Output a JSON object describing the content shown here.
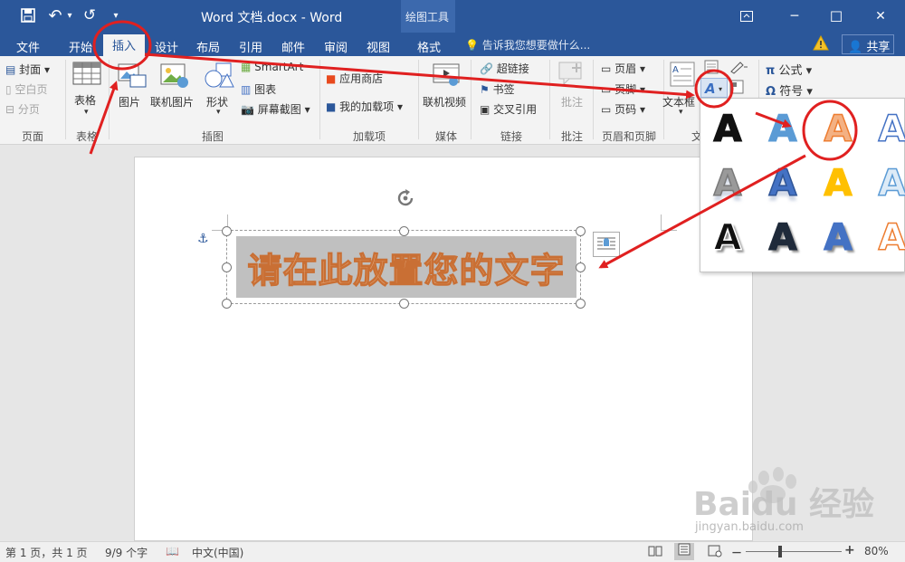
{
  "titlebar": {
    "title": "Word 文档.docx  -  Word",
    "context_tool": "绘图工具",
    "undo_label": "↶",
    "redo_label": "↺",
    "customize_label": "▾",
    "ribbon_display_icon": "ribbon-display-icon",
    "minimize": "─",
    "maximize": "☐",
    "close": "✕"
  },
  "tabs": [
    {
      "label": "文件"
    },
    {
      "label": "开始"
    },
    {
      "label": "插入",
      "active": true
    },
    {
      "label": "设计"
    },
    {
      "label": "布局"
    },
    {
      "label": "引用"
    },
    {
      "label": "邮件"
    },
    {
      "label": "审阅"
    },
    {
      "label": "视图"
    },
    {
      "label": "格式"
    }
  ],
  "tellme": "告诉我您想要做什么...",
  "share": "共享",
  "ribbon": {
    "pages": {
      "cover": "封面",
      "blank": "空白页",
      "break": "分页",
      "group": "页面"
    },
    "tables": {
      "table": "表格",
      "group": "表格"
    },
    "illustrations": {
      "picture": "图片",
      "online_picture": "联机图片",
      "shapes": "形状",
      "smartart": "SmartArt",
      "chart": "图表",
      "screenshot": "屏幕截图",
      "group": "插图"
    },
    "addins": {
      "store": "应用商店",
      "my_addins": "我的加载项",
      "group": "加载项"
    },
    "media": {
      "online_video": "联机视频",
      "group": "媒体"
    },
    "links": {
      "hyperlink": "超链接",
      "bookmark": "书签",
      "cross_ref": "交叉引用",
      "group": "链接"
    },
    "comments": {
      "comment": "批注",
      "group": "批注"
    },
    "header_footer": {
      "header": "页眉",
      "footer": "页脚",
      "page_number": "页码",
      "group": "页眉和页脚"
    },
    "text": {
      "textbox": "文本框",
      "group": "文"
    },
    "symbols": {
      "equation": "公式",
      "symbol": "符号"
    }
  },
  "document": {
    "textbox_text": "请在此放置您的文字"
  },
  "wordart_gallery": [
    {
      "fill": "#111111",
      "stroke": "#111111",
      "style": "plain"
    },
    {
      "fill": "#5b9bd5",
      "stroke": "#5b9bd5",
      "style": "gradient"
    },
    {
      "fill": "#f4b183",
      "stroke": "#ed7d31",
      "style": "orange-selected"
    },
    {
      "fill": "#ffffff",
      "stroke": "#4472c4",
      "style": "outline-blue"
    },
    {
      "fill": "#9a9a9a",
      "stroke": "#7a7a7a",
      "style": "gray"
    },
    {
      "fill": "#4472c4",
      "stroke": "#2f5597",
      "style": "blue-reflect"
    },
    {
      "fill": "#ffc000",
      "stroke": "#ffc000",
      "style": "gold"
    },
    {
      "fill": "#ddebf7",
      "stroke": "#5b9bd5",
      "style": "light-blue"
    },
    {
      "fill": "#111111",
      "stroke": "#ffffff",
      "style": "black-shadow"
    },
    {
      "fill": "#1f2a3a",
      "stroke": "#1f2a3a",
      "style": "dark-shadow"
    },
    {
      "fill": "#4472c4",
      "stroke": "#4472c4",
      "style": "blue-shadow"
    },
    {
      "fill": "#ffffff",
      "stroke": "#ed7d31",
      "style": "outline-orange"
    }
  ],
  "statusbar": {
    "page": "第 1 页，共 1 页",
    "words": "9/9 个字",
    "language": "中文(中国)",
    "zoom": "80%",
    "zoom_minus": "－",
    "zoom_plus": "+"
  },
  "watermark": {
    "brand": "Baidu 经验",
    "url": "jingyan.baidu.com"
  },
  "colors": {
    "accent": "#2b579a",
    "annotation": "#e02020"
  }
}
